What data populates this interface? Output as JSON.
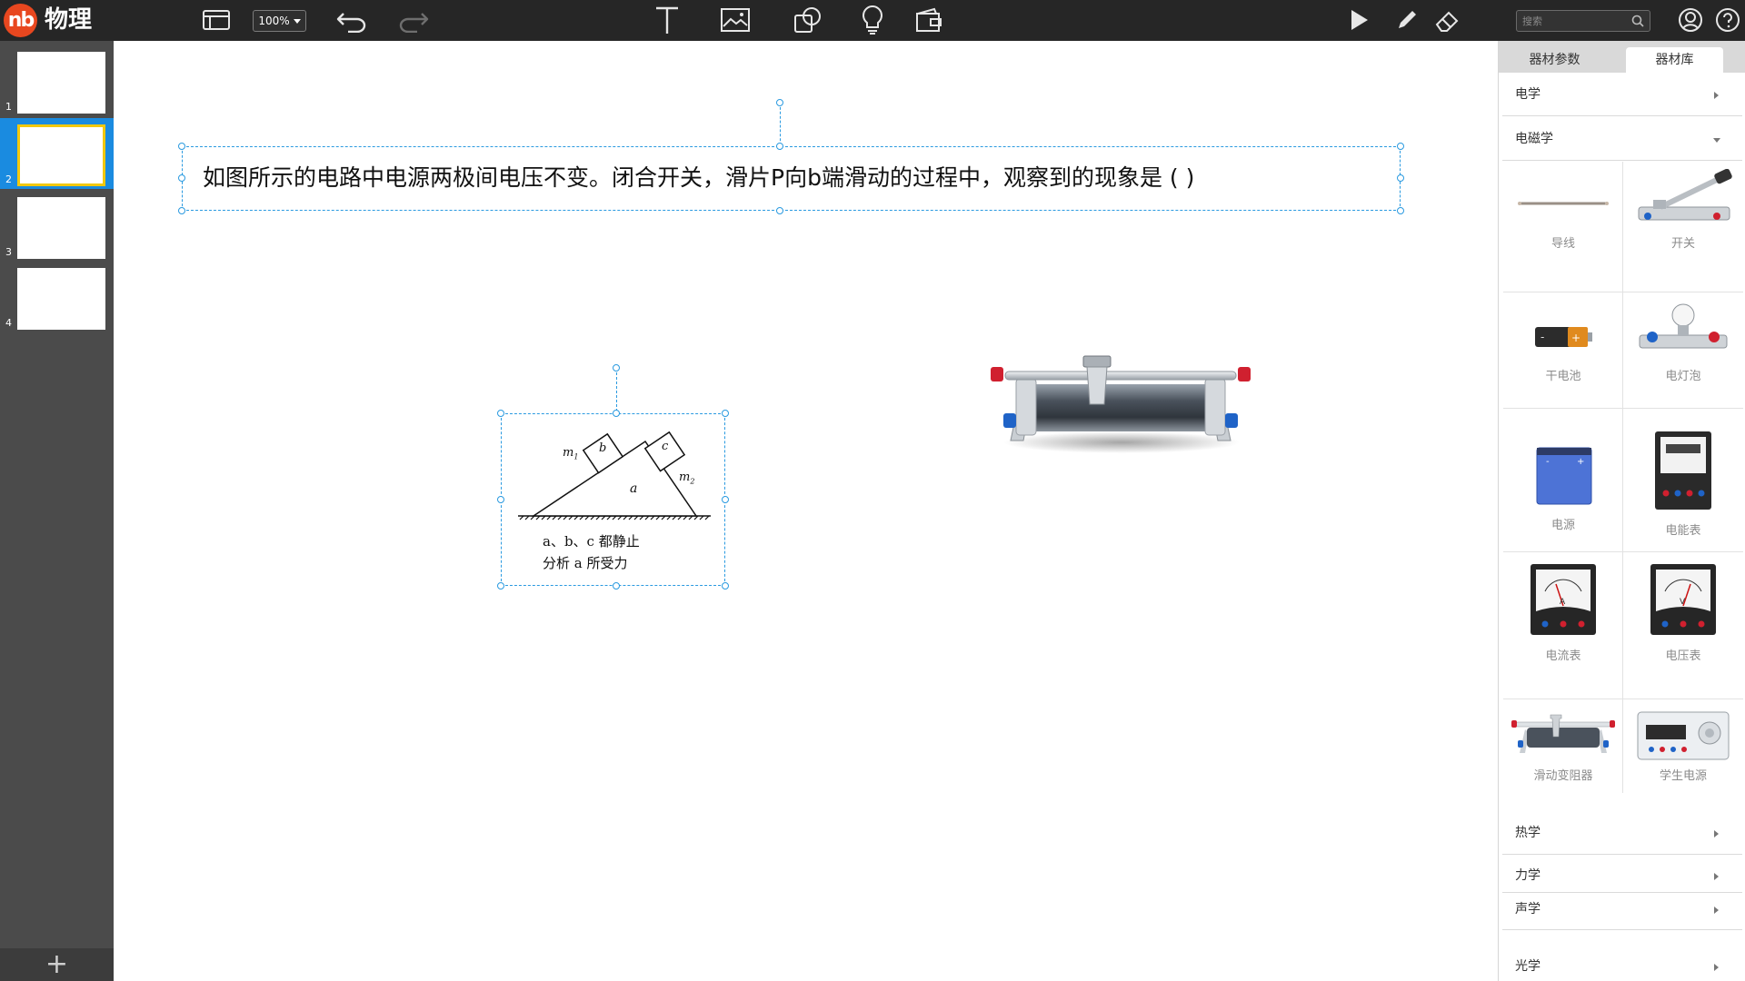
{
  "app": {
    "logo_text": "nb",
    "title": "物理"
  },
  "toolbar": {
    "zoom_level": "100%",
    "search_placeholder": "搜索"
  },
  "slides": [
    {
      "number": "1",
      "active": false
    },
    {
      "number": "2",
      "active": true
    },
    {
      "number": "3",
      "active": false
    },
    {
      "number": "4",
      "active": false
    }
  ],
  "canvas": {
    "question_text": "如图所示的电路中电源两极间电压不变。闭合开关，滑片P向b端滑动的过程中，观察到的现象是 (        )",
    "diagram": {
      "labels": {
        "m1": "m",
        "m1_sub": "1",
        "m2": "m",
        "m2_sub": "2",
        "a": "a",
        "b": "b",
        "c": "c"
      },
      "caption_line1": "a、b、c 都静止",
      "caption_line2": "分析 a 所受力"
    }
  },
  "library": {
    "tabs": [
      {
        "label": "器材参数",
        "active": false
      },
      {
        "label": "器材库",
        "active": true
      }
    ],
    "categories_top": [
      {
        "label": "电学",
        "expanded": false
      },
      {
        "label": "电磁学",
        "expanded": true
      }
    ],
    "items": [
      {
        "name": "导线",
        "icon": "wire-icon"
      },
      {
        "name": "开关",
        "icon": "knife-switch-icon"
      },
      {
        "name": "干电池",
        "icon": "battery-icon"
      },
      {
        "name": "电灯泡",
        "icon": "light-bulb-icon"
      },
      {
        "name": "电源",
        "icon": "power-supply-icon"
      },
      {
        "name": "电能表",
        "icon": "energy-meter-icon"
      },
      {
        "name": "电流表",
        "icon": "ammeter-icon"
      },
      {
        "name": "电压表",
        "icon": "voltmeter-icon"
      },
      {
        "name": "滑动变阻器",
        "icon": "rheostat-icon"
      },
      {
        "name": "学生电源",
        "icon": "student-power-supply-icon"
      }
    ],
    "categories_bottom": [
      {
        "label": "热学"
      },
      {
        "label": "力学"
      },
      {
        "label": "声学"
      },
      {
        "label": "光学"
      }
    ],
    "colors": {
      "accent": "#1a8be0",
      "selection": "#2a9ae0",
      "slide_highlight": "#f2c80d",
      "logo": "#e8471f"
    }
  }
}
